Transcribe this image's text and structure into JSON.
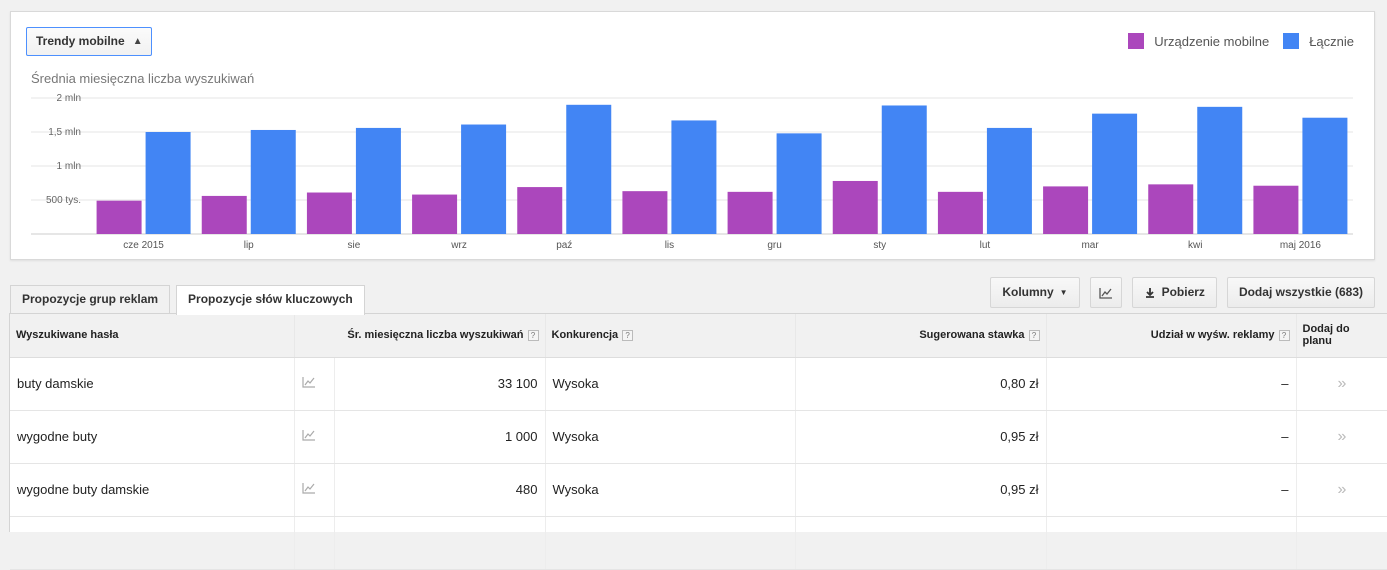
{
  "selector": {
    "label": "Trendy mobilne"
  },
  "legend": [
    {
      "label": "Urządzenie mobilne",
      "color": "#ab47bc"
    },
    {
      "label": "Łącznie",
      "color": "#4285f4"
    }
  ],
  "chart_title": "Średnia miesięczna liczba wyszukiwań",
  "chart_data": {
    "type": "bar",
    "title": "Średnia miesięczna liczba wyszukiwań",
    "categories": [
      "cze 2015",
      "lip",
      "sie",
      "wrz",
      "paź",
      "lis",
      "gru",
      "sty",
      "lut",
      "mar",
      "kwi",
      "maj 2016"
    ],
    "series": [
      {
        "name": "Urządzenie mobilne",
        "color": "#ab47bc",
        "values": [
          490000,
          560000,
          610000,
          580000,
          690000,
          630000,
          620000,
          780000,
          620000,
          700000,
          730000,
          710000
        ]
      },
      {
        "name": "Łącznie",
        "color": "#4285f4",
        "values": [
          1500000,
          1530000,
          1560000,
          1610000,
          1900000,
          1670000,
          1480000,
          1890000,
          1560000,
          1770000,
          1870000,
          1710000
        ]
      }
    ],
    "ylim": [
      0,
      2000000
    ],
    "yticks": [
      {
        "value": 500000,
        "label": "500 tys."
      },
      {
        "value": 1000000,
        "label": "1 mln"
      },
      {
        "value": 1500000,
        "label": "1,5 mln"
      },
      {
        "value": 2000000,
        "label": "2 mln"
      }
    ],
    "grid": true,
    "legend_position": "top-right"
  },
  "tabs": [
    {
      "label": "Propozycje grup reklam",
      "active": false
    },
    {
      "label": "Propozycje słów kluczowych",
      "active": true
    }
  ],
  "toolbar": {
    "columns_label": "Kolumny",
    "download_label": "Pobierz",
    "add_all_label": "Dodaj wszystkie (683)"
  },
  "table": {
    "headers": {
      "keyword": "Wyszukiwane hasła",
      "searches": "Śr. miesięczna liczba wyszukiwań",
      "competition": "Konkurencja",
      "bid": "Sugerowana stawka",
      "share": "Udział w wyśw. reklamy",
      "add": "Dodaj do planu",
      "help": "?"
    },
    "rows": [
      {
        "keyword": "buty damskie",
        "searches": "33 100",
        "competition": "Wysoka",
        "bid": "0,80 zł",
        "share": "–"
      },
      {
        "keyword": "wygodne buty",
        "searches": "1 000",
        "competition": "Wysoka",
        "bid": "0,95 zł",
        "share": "–"
      },
      {
        "keyword": "wygodne buty damskie",
        "searches": "480",
        "competition": "Wysoka",
        "bid": "0,95 zł",
        "share": "–"
      }
    ],
    "add_glyph": "»"
  }
}
